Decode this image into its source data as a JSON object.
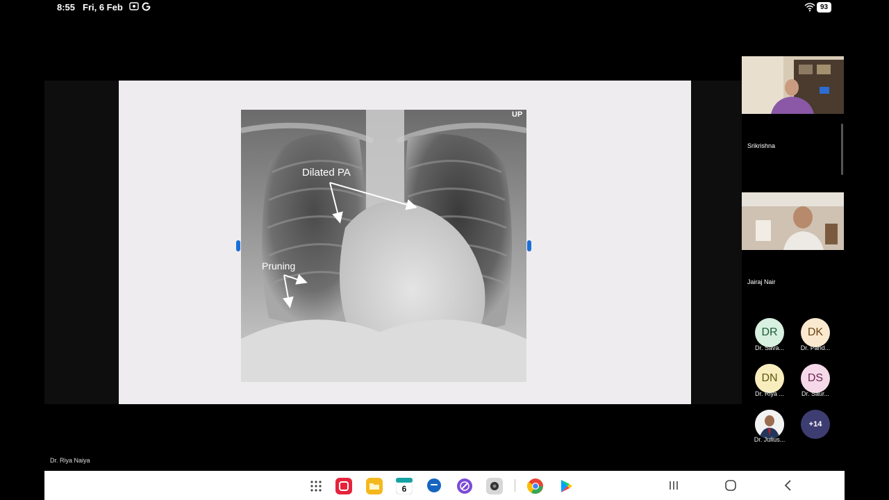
{
  "status_bar": {
    "time": "8:55",
    "date": "Fri, 6 Feb",
    "left_icons": [
      "screen-record-icon",
      "google-icon"
    ],
    "right_icons": [
      "wifi-icon",
      "battery-icon"
    ],
    "battery_level": "93"
  },
  "slide": {
    "corner_label": "UP",
    "annotation_1": "Dilated PA",
    "annotation_2": "Pruning"
  },
  "presenter": {
    "name": "Dr. Riya Naiya"
  },
  "participants": {
    "video_tiles": [
      {
        "name": "Srikrishna"
      },
      {
        "name": "Jairaj Nair"
      }
    ],
    "avatars": [
      {
        "initials": "DR",
        "label": "Dr. Sava...",
        "bg": "#d7f0e0",
        "fg": "#1f5a36"
      },
      {
        "initials": "DK",
        "label": "Dr. Pand...",
        "bg": "#fbe9cf",
        "fg": "#6b4512"
      },
      {
        "initials": "DN",
        "label": "Dr. Riya ...",
        "bg": "#f8eebd",
        "fg": "#5f5410"
      },
      {
        "initials": "DS",
        "label": "Dr. Saur...",
        "bg": "#f6d9e9",
        "fg": "#6b2450"
      },
      {
        "initials": "",
        "label": "Dr. Julius...",
        "bg": "#e8e8e8",
        "fg": "#222"
      }
    ],
    "more_count": "+14",
    "more_bg": "#3d3d72"
  },
  "nav_bar": {
    "apps": [
      {
        "icon": "app-drawer-icon",
        "color": "#444444"
      },
      {
        "icon": "red-app-icon",
        "color": "#e5243b"
      },
      {
        "icon": "my-files-icon",
        "color": "#f5b81c"
      },
      {
        "icon": "calendar-icon",
        "color": "#1e88e5",
        "badge": "6"
      },
      {
        "icon": "messages-icon",
        "color": "#1565c0"
      },
      {
        "icon": "notes-icon",
        "color": "#7b4bd6"
      },
      {
        "icon": "camera-icon",
        "color": "#9e9e9e"
      },
      {
        "icon": "chrome-icon",
        "color": "#34a853"
      },
      {
        "icon": "play-store-icon",
        "color": "#01875f"
      }
    ],
    "system": [
      "recents-icon",
      "home-icon",
      "back-icon"
    ]
  }
}
